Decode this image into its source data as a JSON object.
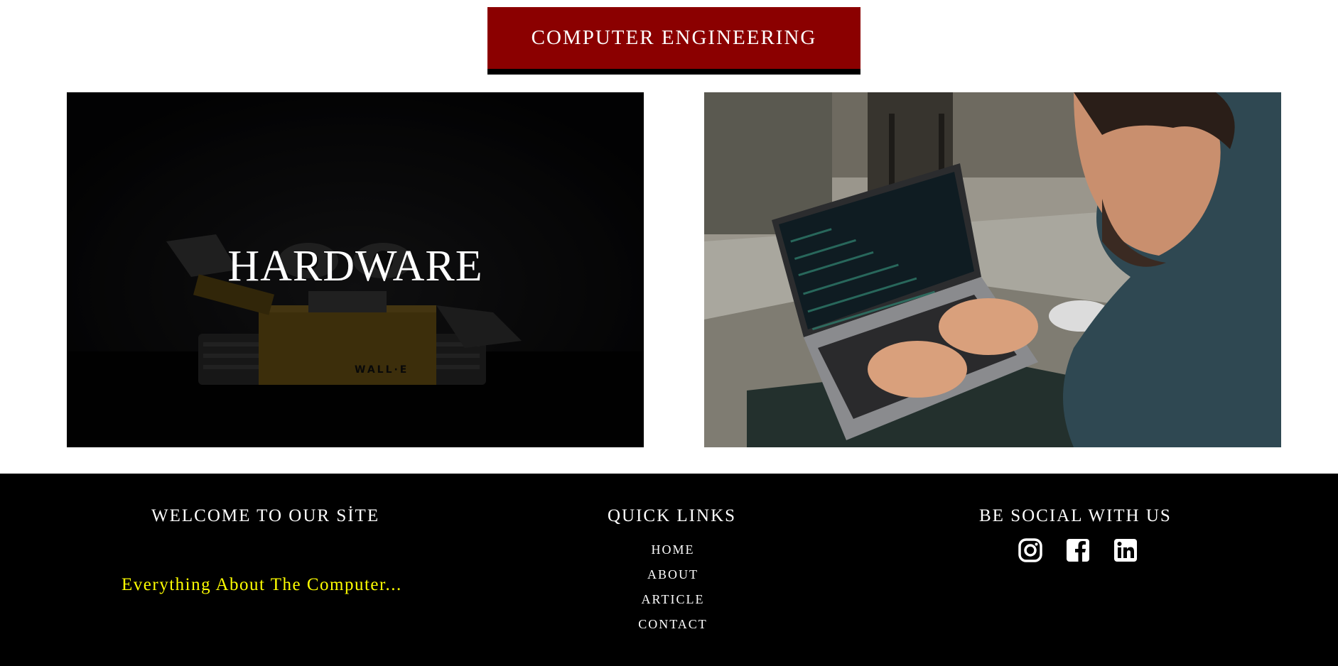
{
  "header": {
    "title": "COMPUTER ENGINEERING"
  },
  "cards": [
    {
      "label": "HARDWARE",
      "image": "robot-photo"
    },
    {
      "label": "",
      "image": "person-coding-laptop-photo"
    }
  ],
  "footer": {
    "welcome": {
      "heading": "WELCOME TO OUR SİTE",
      "tagline": "Everything About The Computer..."
    },
    "quick_links": {
      "heading": "QUICK LINKS",
      "items": [
        "HOME",
        "ABOUT",
        "ARTICLE",
        "CONTACT"
      ]
    },
    "social": {
      "heading": "BE SOCIAL WITH US",
      "icons": [
        "instagram-icon",
        "facebook-icon",
        "linkedin-icon"
      ]
    }
  },
  "colors": {
    "title_bg": "#8b0000",
    "footer_bg": "#000000",
    "tagline": "#ffff00"
  }
}
